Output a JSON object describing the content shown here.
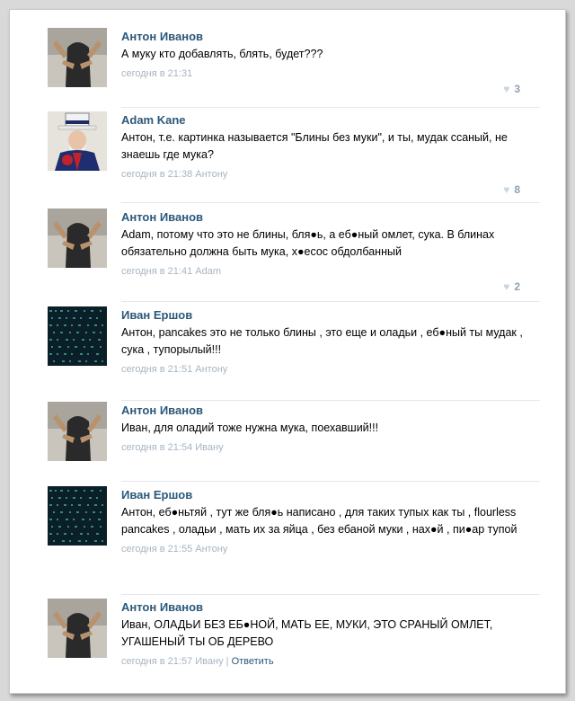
{
  "comments": [
    {
      "author": "Антон Иванов",
      "text": "А муку кто добавлять, блять, будет???",
      "time": "сегодня в 21:31",
      "likes": "3"
    },
    {
      "author": "Adam Kane",
      "text": "Антон, т.е. картинка называется \"Блины без муки\", и ты, мудак ссаный, не знаешь где мука?",
      "time": "сегодня в 21:38 Антону",
      "likes": "8"
    },
    {
      "author": "Антон Иванов",
      "text": "Adam, потому что это не блины, бля●ь, а еб●ный омлет, сука. В блинах обязательно должна быть мука, х●есос обдолбанный",
      "time": "сегодня в 21:41 Adam",
      "likes": "2"
    },
    {
      "author": "Иван Ершов",
      "text": "Антон, pancakes это не только блины , это еще и оладьи , еб●ный ты мудак , сука , тупорылый!!!",
      "time": "сегодня в 21:51 Антону"
    },
    {
      "author": "Антон Иванов",
      "text": "Иван, для оладий тоже нужна мука, поехавший!!!",
      "time": "сегодня в 21:54 Ивану"
    },
    {
      "author": "Иван Ершов",
      "text": "Антон, еб●ньтяй , тут же бля●ь написано , для таких тупых как ты , flourless pancakes , оладьи , мать их за яйца , без ебаной муки , нах●й , пи●ар тупой",
      "time": "сегодня в 21:55 Антону"
    },
    {
      "author": "Антон Иванов",
      "text": "Иван, ОЛАДЬИ БЕЗ ЕБ●НОЙ, МАТЬ ЕЕ, МУКИ, ЭТО СРАНЫЙ ОМЛЕТ, УГАШЕНЫЙ ТЫ ОБ ДЕРЕВО",
      "time": "сегодня в 21:57 Ивану",
      "reply": "Ответить"
    }
  ],
  "icons": {
    "like": "heart-icon"
  },
  "colors": {
    "author": "#2b587a",
    "meta": "#a8b4c2",
    "likes": "#8fa1b6"
  }
}
